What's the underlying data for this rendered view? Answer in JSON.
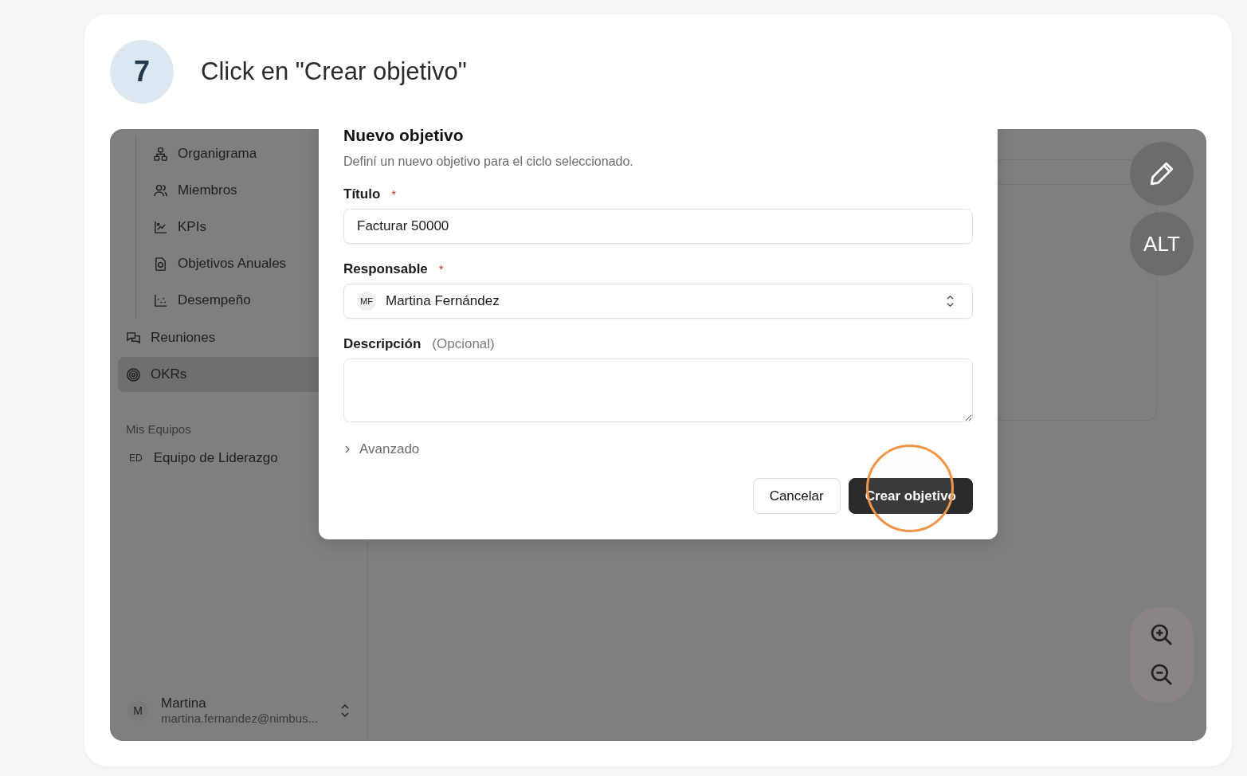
{
  "step": {
    "number": "7",
    "instruction": "Click en \"Crear objetivo\""
  },
  "sidebar": {
    "subitems": [
      {
        "label": "Organigrama"
      },
      {
        "label": "Miembros"
      },
      {
        "label": "KPIs"
      },
      {
        "label": "Objetivos Anuales"
      },
      {
        "label": "Desempeño"
      }
    ],
    "items": [
      {
        "label": "Reuniones",
        "selected": false
      },
      {
        "label": "OKRs",
        "selected": true
      }
    ],
    "teams_heading": "Mis Equipos",
    "teams": [
      {
        "initials": "ED",
        "name": "Equipo de Liderazgo"
      }
    ],
    "user": {
      "initial": "M",
      "name": "Martina",
      "email": "martina.fernandez@nimbus..."
    }
  },
  "dialog": {
    "title": "Nuevo objetivo",
    "description": "Definí un nuevo objetivo para el ciclo seleccionado.",
    "fields": [
      {
        "kind": "text",
        "label": "Título",
        "required_mark": "*",
        "value": "Facturar 50000"
      },
      {
        "kind": "select",
        "label": "Responsable",
        "required_mark": "*",
        "initials": "MF",
        "value": "Martina Fernández"
      },
      {
        "kind": "textarea",
        "label": "Descripción",
        "hint": "(Opcional)"
      }
    ],
    "advanced": "Avanzado",
    "buttons": [
      {
        "kind": "secondary",
        "label": "Cancelar",
        "highlighted": false
      },
      {
        "kind": "primary",
        "label": "Crear objetivo",
        "highlighted": true
      }
    ]
  },
  "floating_buttons": [
    {
      "kind": "edit"
    },
    {
      "kind": "text",
      "label": "ALT"
    }
  ]
}
